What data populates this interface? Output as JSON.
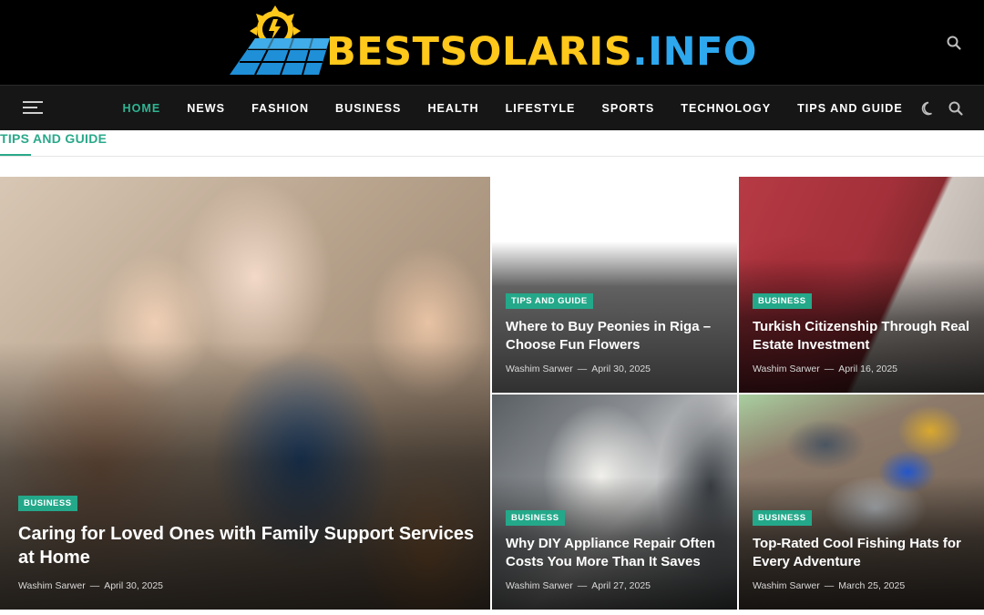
{
  "header": {
    "logo_text_primary": "BESTSOLARIS",
    "logo_text_secondary": ".INFO",
    "search_icon": "search-icon"
  },
  "nav": {
    "menu_icon": "hamburger-menu-icon",
    "items": [
      {
        "label": "HOME",
        "active": true
      },
      {
        "label": "NEWS",
        "active": false
      },
      {
        "label": "FASHION",
        "active": false
      },
      {
        "label": "BUSINESS",
        "active": false
      },
      {
        "label": "HEALTH",
        "active": false
      },
      {
        "label": "LIFESTYLE",
        "active": false
      },
      {
        "label": "SPORTS",
        "active": false
      },
      {
        "label": "TECHNOLOGY",
        "active": false
      },
      {
        "label": "TIPS AND GUIDE",
        "active": false
      }
    ],
    "theme_icon": "moon-icon",
    "search_icon": "search-icon"
  },
  "section": {
    "heading": "TIPS AND GUIDE"
  },
  "articles": [
    {
      "category": "BUSINESS",
      "title": "Caring for Loved Ones with Family Support Services at Home",
      "author": "Washim Sarwer",
      "date": "April 30, 2025"
    },
    {
      "category": "TIPS AND GUIDE",
      "title": "Where to Buy Peonies in Riga – Choose Fun Flowers",
      "author": "Washim Sarwer",
      "date": "April 30, 2025"
    },
    {
      "category": "BUSINESS",
      "title": "Turkish Citizenship Through Real Estate Investment",
      "author": "Washim Sarwer",
      "date": "April 16, 2025"
    },
    {
      "category": "BUSINESS",
      "title": "Why DIY Appliance Repair Often Costs You More Than It Saves",
      "author": "Washim Sarwer",
      "date": "April 27, 2025"
    },
    {
      "category": "BUSINESS",
      "title": "Top-Rated Cool Fishing Hats for Every Adventure",
      "author": "Washim Sarwer",
      "date": "March 25, 2025"
    }
  ],
  "colors": {
    "accent": "#2aa98a",
    "nav_active": "#2fb592",
    "logo_yellow": "#ffc81a",
    "logo_blue": "#2da7ee",
    "header_bg": "#000000",
    "nav_bg": "#161616"
  }
}
